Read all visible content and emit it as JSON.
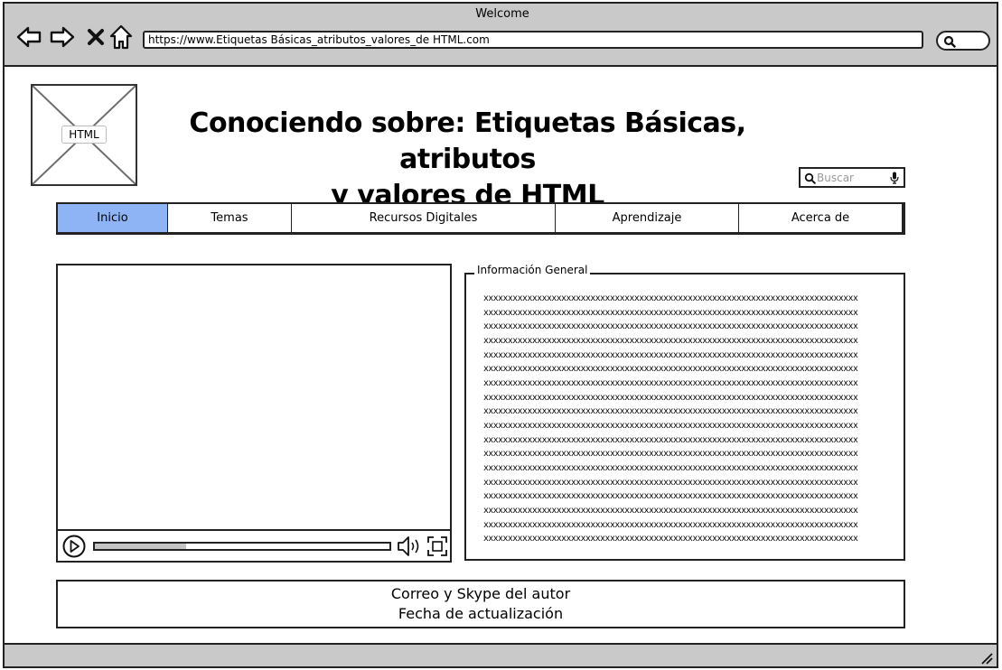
{
  "browser": {
    "window_title": "Welcome",
    "url": "https://www.Etiquetas Básicas_atributos_valores_de HTML.com",
    "icons": [
      "back-arrow-icon",
      "forward-arrow-icon",
      "close-x-icon",
      "home-icon",
      "search-icon"
    ]
  },
  "header": {
    "logo_label": "HTML",
    "title_line1": "Conociendo sobre: Etiquetas Básicas, atributos",
    "title_line2": "y valores de HTML",
    "search_placeholder": "Buscar"
  },
  "nav": {
    "active_color": "#8fb4f5",
    "tabs": [
      {
        "label": "Inicio",
        "active": true
      },
      {
        "label": "Temas",
        "active": false
      },
      {
        "label": "Recursos Digitales",
        "active": false
      },
      {
        "label": "Aprendizaje",
        "active": false
      },
      {
        "label": "Acerca de",
        "active": false
      }
    ]
  },
  "video": {
    "progress": 0.31
  },
  "info": {
    "legend": "Información General",
    "text": "xxxxxxxxxxxxxxxxxxxxxxxxxxxxxxxxxxxxxxxxxxxxxxxxxxxxxxxxxxxxxxxxxxxxxxxxxxxxx\nxxxxxxxxxxxxxxxxxxxxxxxxxxxxxxxxxxxxxxxxxxxxxxxxxxxxxxxxxxxxxxxxxxxxxxxxxxxxx\nxxxxxxxxxxxxxxxxxxxxxxxxxxxxxxxxxxxxxxxxxxxxxxxxxxxxxxxxxxxxxxxxxxxxxxxxxxxxx\nxxxxxxxxxxxxxxxxxxxxxxxxxxxxxxxxxxxxxxxxxxxxxxxxxxxxxxxxxxxxxxxxxxxxxxxxxxxxx\nxxxxxxxxxxxxxxxxxxxxxxxxxxxxxxxxxxxxxxxxxxxxxxxxxxxxxxxxxxxxxxxxxxxxxxxxxxxxx\nxxxxxxxxxxxxxxxxxxxxxxxxxxxxxxxxxxxxxxxxxxxxxxxxxxxxxxxxxxxxxxxxxxxxxxxxxxxxx\nxxxxxxxxxxxxxxxxxxxxxxxxxxxxxxxxxxxxxxxxxxxxxxxxxxxxxxxxxxxxxxxxxxxxxxxxxxxxx\nxxxxxxxxxxxxxxxxxxxxxxxxxxxxxxxxxxxxxxxxxxxxxxxxxxxxxxxxxxxxxxxxxxxxxxxxxxxxx\nxxxxxxxxxxxxxxxxxxxxxxxxxxxxxxxxxxxxxxxxxxxxxxxxxxxxxxxxxxxxxxxxxxxxxxxxxxxxx\nxxxxxxxxxxxxxxxxxxxxxxxxxxxxxxxxxxxxxxxxxxxxxxxxxxxxxxxxxxxxxxxxxxxxxxxxxxxxx\nxxxxxxxxxxxxxxxxxxxxxxxxxxxxxxxxxxxxxxxxxxxxxxxxxxxxxxxxxxxxxxxxxxxxxxxxxxxxx\nxxxxxxxxxxxxxxxxxxxxxxxxxxxxxxxxxxxxxxxxxxxxxxxxxxxxxxxxxxxxxxxxxxxxxxxxxxxxx\nxxxxxxxxxxxxxxxxxxxxxxxxxxxxxxxxxxxxxxxxxxxxxxxxxxxxxxxxxxxxxxxxxxxxxxxxxxxxx\nxxxxxxxxxxxxxxxxxxxxxxxxxxxxxxxxxxxxxxxxxxxxxxxxxxxxxxxxxxxxxxxxxxxxxxxxxxxxx\nxxxxxxxxxxxxxxxxxxxxxxxxxxxxxxxxxxxxxxxxxxxxxxxxxxxxxxxxxxxxxxxxxxxxxxxxxxxxx\nxxxxxxxxxxxxxxxxxxxxxxxxxxxxxxxxxxxxxxxxxxxxxxxxxxxxxxxxxxxxxxxxxxxxxxxxxxxxx\nxxxxxxxxxxxxxxxxxxxxxxxxxxxxxxxxxxxxxxxxxxxxxxxxxxxxxxxxxxxxxxxxxxxxxxxxxxxxx\nxxxxxxxxxxxxxxxxxxxxxxxxxxxxxxxxxxxxxxxxxxxxxxxxxxxxxxxxxxxxxxxxxxxxxxxxxxxxx"
  },
  "footer": {
    "line1": "Correo y Skype del autor",
    "line2": "Fecha de actualización"
  }
}
